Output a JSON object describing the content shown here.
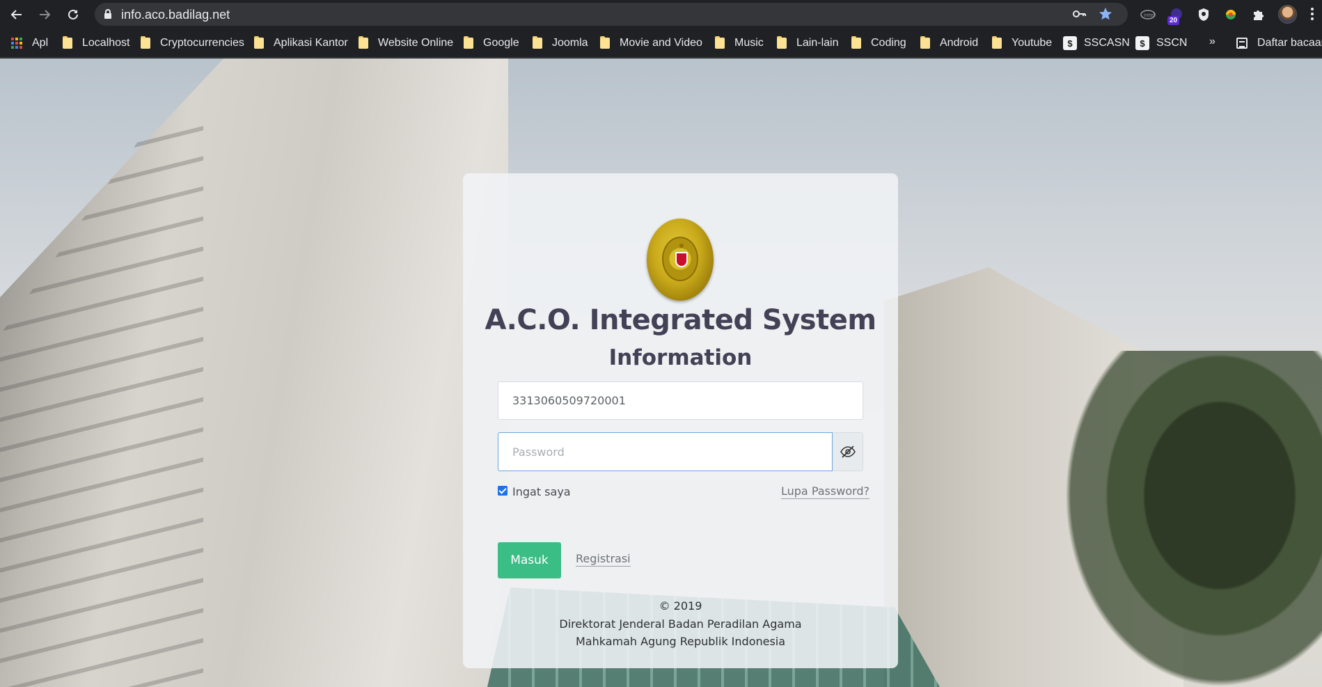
{
  "browser": {
    "url": "info.aco.badilag.net",
    "extension_badge": "20",
    "bookmarks": [
      {
        "label": "Apl",
        "icon": "apps-grid-icon"
      },
      {
        "label": "Localhost",
        "icon": "folder-icon"
      },
      {
        "label": "Cryptocurrencies",
        "icon": "folder-icon"
      },
      {
        "label": "Aplikasi Kantor",
        "icon": "folder-icon"
      },
      {
        "label": "Website Online",
        "icon": "folder-icon"
      },
      {
        "label": "Google",
        "icon": "folder-icon"
      },
      {
        "label": "Joomla",
        "icon": "folder-icon"
      },
      {
        "label": "Movie and Video",
        "icon": "folder-icon"
      },
      {
        "label": "Music",
        "icon": "folder-icon"
      },
      {
        "label": "Lain-lain",
        "icon": "folder-icon"
      },
      {
        "label": "Coding",
        "icon": "folder-icon"
      },
      {
        "label": "Android",
        "icon": "folder-icon"
      },
      {
        "label": "Youtube",
        "icon": "folder-icon"
      },
      {
        "label": "SSCASN",
        "icon": "site-favicon"
      },
      {
        "label": "SSCN",
        "icon": "site-favicon"
      }
    ],
    "more_bookmarks": "»",
    "reading_list": "Daftar bacaan"
  },
  "login": {
    "title_line1": "A.C.O. Integrated System",
    "title_line2": "Information",
    "username_value": "3313060509720001",
    "password_placeholder": "Password",
    "remember_label": "Ingat saya",
    "remember_checked": true,
    "forgot_label": "Lupa Password?",
    "submit_label": "Masuk",
    "register_label": "Registrasi",
    "footer_copyright": "© 2019",
    "footer_line2": "Direktorat Jenderal Badan Peradilan Agama",
    "footer_line3": "Mahkamah Agung Republik Indonesia"
  },
  "colors": {
    "submit_button": "#3bbd86",
    "title_text": "#434156",
    "browser_chrome": "#202124",
    "active_input_border": "#6aa6dd"
  }
}
